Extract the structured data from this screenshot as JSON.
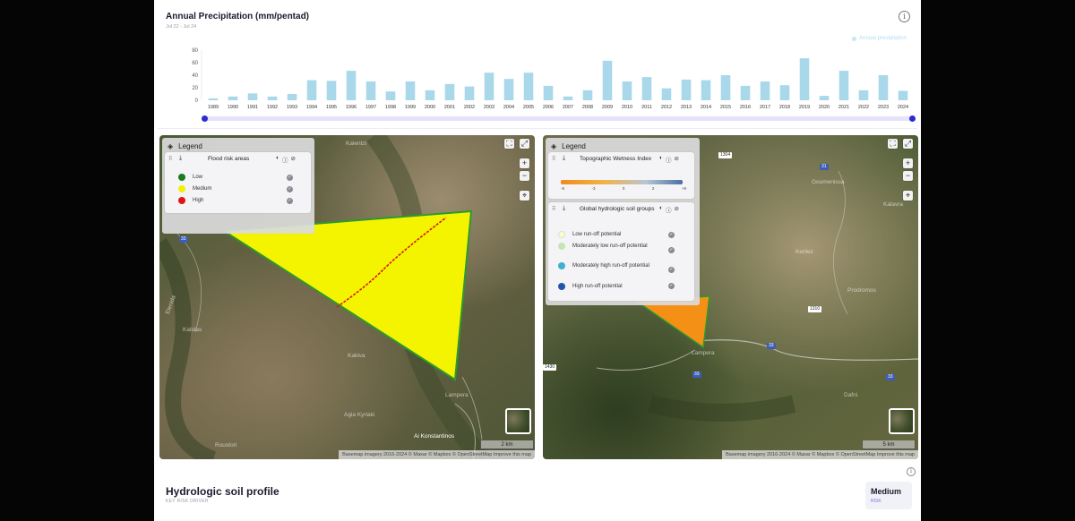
{
  "chart_card": {
    "title": "Annual Precipitation (mm/pentad)",
    "subtitle": "Jul 22 - Jul 24",
    "info_icon": "info-icon",
    "legend_label": "Annual precipitation",
    "bar_color": "#a8d8ea"
  },
  "chart_data": {
    "type": "bar",
    "title": "Annual Precipitation (mm/pentad)",
    "categories": [
      "1989",
      "1990",
      "1991",
      "1992",
      "1993",
      "1994",
      "1995",
      "1996",
      "1997",
      "1998",
      "1999",
      "2000",
      "2001",
      "2002",
      "2003",
      "2004",
      "2005",
      "2006",
      "2007",
      "2008",
      "2009",
      "2010",
      "2011",
      "2012",
      "2013",
      "2014",
      "2015",
      "2016",
      "2017",
      "2018",
      "2019",
      "2020",
      "2021",
      "2022",
      "2023",
      "2024"
    ],
    "series": [
      {
        "name": "Annual precipitation",
        "values": [
          3,
          6,
          11,
          6,
          10,
          32,
          31,
          47,
          30,
          14,
          30,
          16,
          26,
          22,
          44,
          34,
          44,
          23,
          6,
          16,
          63,
          30,
          37,
          19,
          33,
          32,
          40,
          23,
          30,
          24,
          67,
          7,
          47,
          16,
          40,
          15
        ]
      }
    ],
    "yticks": [
      "0",
      "20",
      "40",
      "60",
      "80"
    ],
    "ylim": [
      0,
      80
    ],
    "xlabel": "",
    "ylabel": "",
    "grid": false,
    "legend": "top-right"
  },
  "left_map": {
    "legend_title": "Legend",
    "layer_title": "Flood risk areas",
    "classes": [
      {
        "label": "Low",
        "color": "#1d7a1d"
      },
      {
        "label": "Medium",
        "color": "#f2f200"
      },
      {
        "label": "High",
        "color": "#e01414"
      }
    ],
    "places": [
      "Kalentzi",
      "Kalidas",
      "Lampera",
      "Ai Konstantinos",
      "Agia Kyriaki",
      "Kakiva",
      "Roustori",
      "Elenida"
    ],
    "roads": [
      "33"
    ],
    "scale": "2 km",
    "attribution": "Basemap imagery 2016-2024 © Maxar © Mapbox © OpenStreetMap Improve this map"
  },
  "right_map": {
    "legend_title": "Legend",
    "twi_title": "Topographic Wetness Index",
    "twi_ticks": [
      "-5",
      "-3",
      "0",
      "2",
      "+9"
    ],
    "soil_title": "Global hydrologic soil groups",
    "soil_classes": [
      {
        "label": "Low run-off potential",
        "color": "#fdfdc6"
      },
      {
        "label": "Moderately low run-off potential",
        "color": "#c3e6b4"
      },
      {
        "label": "Moderately high run-off potential",
        "color": "#3fb0cf"
      },
      {
        "label": "High run-off potential",
        "color": "#2256a8"
      }
    ],
    "places": [
      "Goumenissa",
      "Kalavra",
      "Kerilez",
      "Prodromos",
      "Lampera",
      "Dafni"
    ],
    "roads": [
      "1304",
      "31",
      "1310",
      "33",
      "33",
      "1430",
      "33"
    ],
    "scale": "5 km",
    "attribution": "Basemap imagery 2016-2024 © Maxar © Mapbox © OpenStreetMap Improve this map"
  },
  "profile": {
    "title": "Hydrologic soil profile",
    "subtitle": "KEY RISK DRIVER",
    "risk_level": "Medium",
    "risk_label": "RISK"
  }
}
